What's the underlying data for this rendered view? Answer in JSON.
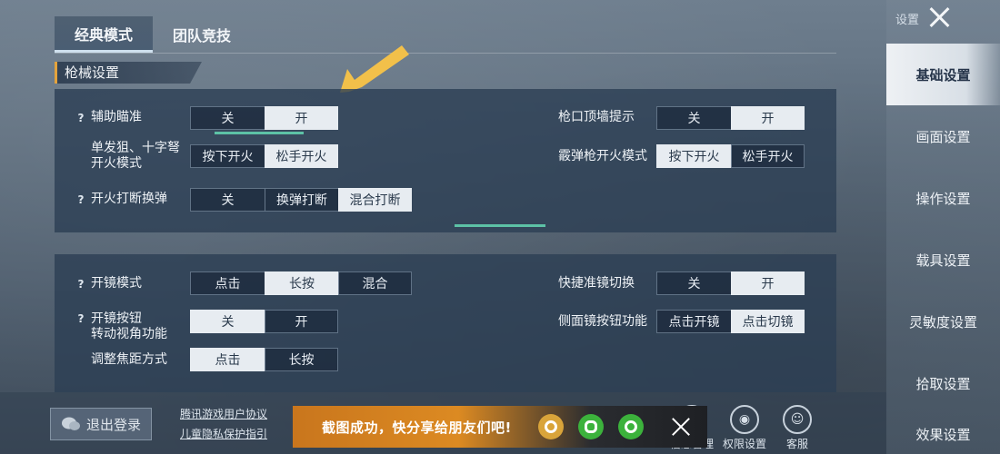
{
  "tabs": [
    {
      "label": "经典模式",
      "active": true
    },
    {
      "label": "团队竞技",
      "active": false
    }
  ],
  "section_title": "枪械设置",
  "panel1": {
    "aim_assist": {
      "label": "辅助瞄准",
      "options": [
        "关",
        "开"
      ],
      "selected": "开"
    },
    "sniper_fire": {
      "label_line1": "单发狙、十字弩",
      "label_line2": "开火模式",
      "options": [
        "按下开火",
        "松手开火"
      ],
      "selected": "松手开火"
    },
    "fire_interrupt": {
      "label": "开火打断换弹",
      "options": [
        "关",
        "换弹打断",
        "混合打断"
      ],
      "selected": "混合打断"
    },
    "muzzle_wall": {
      "label": "枪口顶墙提示",
      "options": [
        "关",
        "开"
      ],
      "selected": "开"
    },
    "shotgun_fire": {
      "label": "霰弹枪开火模式",
      "options": [
        "按下开火",
        "松手开火"
      ],
      "selected": "按下开火"
    }
  },
  "panel2": {
    "scope_mode": {
      "label": "开镜模式",
      "options": [
        "点击",
        "长按",
        "混合"
      ],
      "selected": "长按"
    },
    "scope_button_view": {
      "label_line1": "开镜按钮",
      "label_line2": "转动视角功能",
      "options": [
        "关",
        "开"
      ],
      "selected": "关"
    },
    "zoom_method": {
      "label": "调整焦距方式",
      "options": [
        "点击",
        "长按"
      ],
      "selected": "点击"
    },
    "quick_scope_switch": {
      "label": "快捷准镜切换",
      "options": [
        "关",
        "开"
      ],
      "selected": "开"
    },
    "side_scope_button": {
      "label": "侧面镜按钮功能",
      "options": [
        "点击开镜",
        "点击切镜"
      ],
      "selected": "点击切镜"
    }
  },
  "sidebar": {
    "header": "设置",
    "items": [
      "基础设置",
      "画面设置",
      "操作设置",
      "载具设置",
      "灵敏度设置",
      "拾取设置",
      "效果设置"
    ],
    "active": "基础设置"
  },
  "bottom": {
    "logout_label": "退出登录",
    "link1": "腾讯游戏用户协议",
    "link2": "儿童隐私保护指引",
    "icons": [
      {
        "name": "profile-icon",
        "caption": "信息管理"
      },
      {
        "name": "permission-icon",
        "caption": "权限设置"
      },
      {
        "name": "service-icon",
        "caption": "客服"
      }
    ]
  },
  "banner": {
    "text": "截图成功，快分享给朋友们吧!"
  },
  "colors": {
    "accent_green": "#5dc2a6",
    "section_accent": "#e4a33c",
    "banner_orange": "#dc8a22",
    "arrow": "#f2c04a"
  }
}
